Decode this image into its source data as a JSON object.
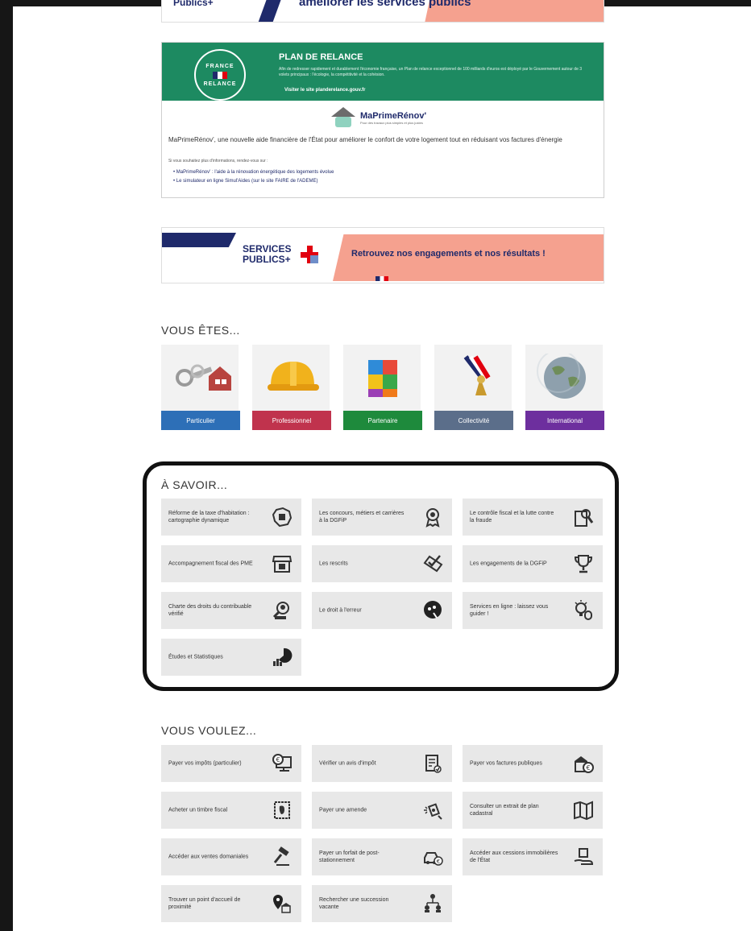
{
  "top_banner": {
    "left_text": "Publics+",
    "text": "améliorer les services publics"
  },
  "relance": {
    "logo_top": "FRANCE",
    "logo_bottom": "RELANCE",
    "title": "PLAN DE RELANCE",
    "description": "Afin de redresser rapidement et durablement l'économie française, un Plan de relance exceptionnel de 100 milliards d'euros est déployé par le Gouvernement autour de 3 volets principaux : l'écologie, la compétitivité et la cohésion.",
    "link": "Visiter le site planderelance.gouv.fr",
    "mpr_name": "MaPrimeRénov'",
    "mpr_sub": "Pour des travaux plus simples et plus justes",
    "body": "MaPrimeRénov', une nouvelle aide financière de l'État pour améliorer le confort de votre logement tout en réduisant vos factures d'énergie",
    "small": "Si vous souhaitez plus d'informations, rendez-vous sur :",
    "links": [
      "MaPrimeRénov' : l'aide à la rénovation énergétique des logements évolue",
      "Le simulateur en ligne Simul'Aides (sur le site FAIRE de l'ADEME)"
    ]
  },
  "sp_banner": {
    "logo_line1": "SERVICES",
    "logo_line2": "PUBLICS+",
    "text": "Retrouvez nos engagements et nos résultats !"
  },
  "vous_etes": {
    "title": "VOUS ÊTES...",
    "items": [
      {
        "label": "Particulier",
        "color": "#2d6fb7",
        "icon": "keys-house-icon"
      },
      {
        "label": "Professionnel",
        "color": "#c0334d",
        "icon": "hard-hat-icon"
      },
      {
        "label": "Partenaire",
        "color": "#1e8a3c",
        "icon": "puzzle-cube-icon"
      },
      {
        "label": "Collectivité",
        "color": "#5b6e8a",
        "icon": "medal-ribbon-icon"
      },
      {
        "label": "International",
        "color": "#6d2f9e",
        "icon": "globe-icon"
      }
    ]
  },
  "a_savoir": {
    "title": "À SAVOIR...",
    "items": [
      {
        "label": "Réforme de la taxe d'habitation : cartographie dynamique",
        "icon": "map-france-icon"
      },
      {
        "label": "Les concours, métiers et carrières à la DGFiP",
        "icon": "award-icon"
      },
      {
        "label": "Le contrôle fiscal et la lutte contre la fraude",
        "icon": "magnifier-document-icon"
      },
      {
        "label": "Accompagnement fiscal des PME",
        "icon": "shop-icon"
      },
      {
        "label": "Les rescrits",
        "icon": "checklist-icon"
      },
      {
        "label": "Les engagements de la DGFiP",
        "icon": "trophy-icon"
      },
      {
        "label": "Charte des droits du contribuable vérifié",
        "icon": "person-search-icon"
      },
      {
        "label": "Le droit à l'erreur",
        "icon": "chat-bubble-icon"
      },
      {
        "label": "Services en ligne : laissez vous guider !",
        "icon": "lightbulb-mouse-icon"
      },
      {
        "label": "Études et Statistiques",
        "icon": "pie-chart-icon"
      }
    ]
  },
  "vous_voulez": {
    "title": "VOUS VOULEZ...",
    "items": [
      {
        "label": "Payer vos impôts (particulier)",
        "icon": "computer-euro-icon"
      },
      {
        "label": "Vérifier un avis d'impôt",
        "icon": "document-check-icon"
      },
      {
        "label": "Payer vos factures publiques",
        "icon": "building-euro-icon"
      },
      {
        "label": "Acheter un timbre fiscal",
        "icon": "stamp-icon"
      },
      {
        "label": "Payer une amende",
        "icon": "speed-camera-icon"
      },
      {
        "label": "Consulter un extrait de plan cadastral",
        "icon": "map-icon"
      },
      {
        "label": "Accéder aux ventes domaniales",
        "icon": "auction-hammer-icon"
      },
      {
        "label": "Payer un forfait de post-stationnement",
        "icon": "car-euro-icon"
      },
      {
        "label": "Accéder aux cessions immobilières de l'État",
        "icon": "hand-building-icon"
      },
      {
        "label": "Trouver un point d'accueil de proximité",
        "icon": "location-building-icon"
      },
      {
        "label": "Rechercher une succession vacante",
        "icon": "family-tree-icon"
      }
    ]
  }
}
